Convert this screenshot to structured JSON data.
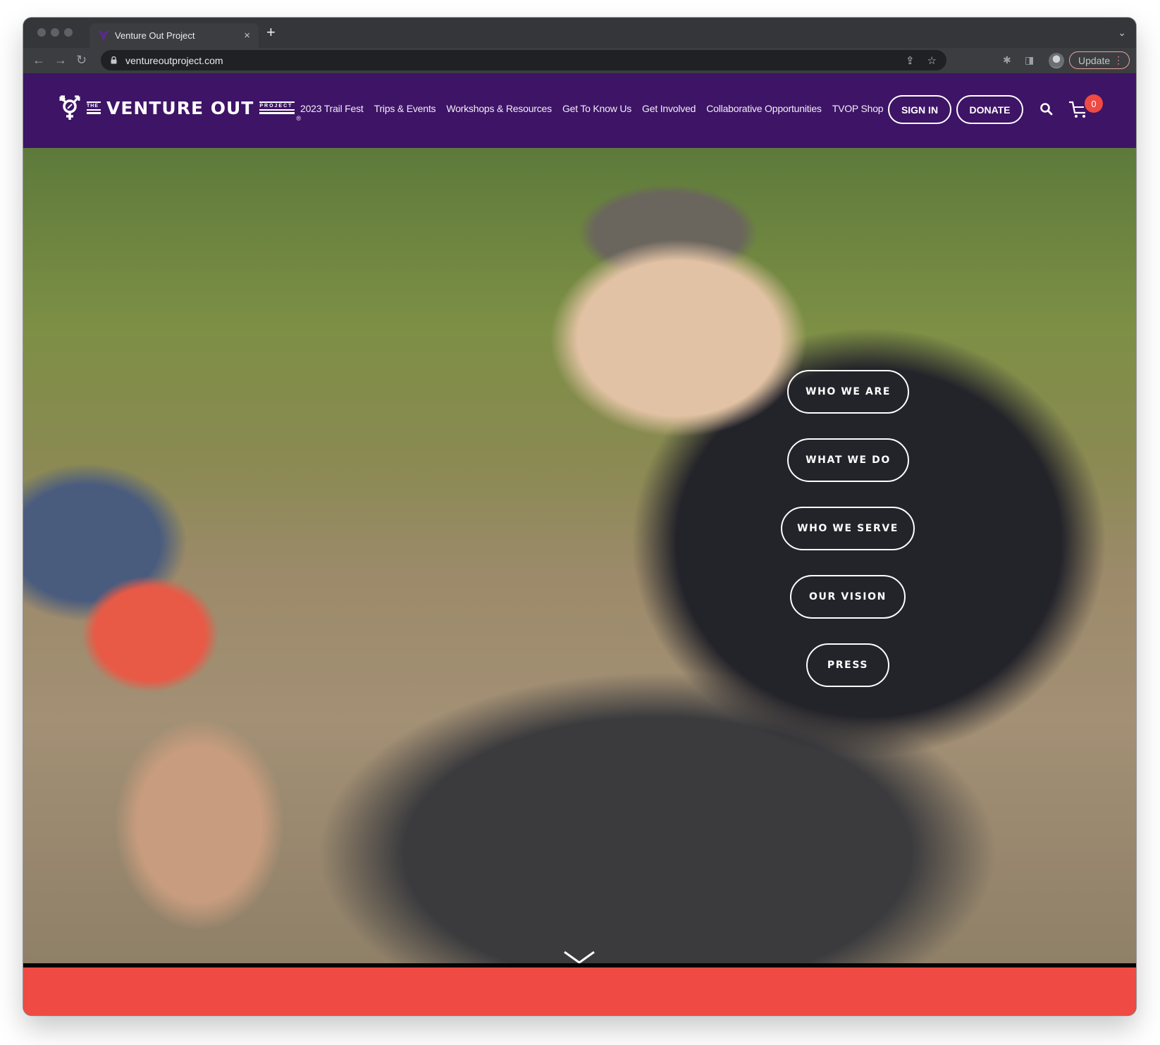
{
  "browser": {
    "tab_title": "Venture Out Project",
    "tab_close": "×",
    "new_tab": "+",
    "tab_menu": "⌄",
    "url": "ventureoutproject.com",
    "back": "←",
    "forward": "→",
    "reload": "↻",
    "share": "⇪",
    "bookmark": "☆",
    "extensions": "✱",
    "sidepanel": "◨",
    "update_label": "Update",
    "menu_dots": "⋮"
  },
  "site": {
    "logo": {
      "the": "THE",
      "name": "VENTURE OUT",
      "project": "PROJECT",
      "registered": "®"
    },
    "nav": [
      {
        "label": "2023 Trail Fest"
      },
      {
        "label": "Trips & Events"
      },
      {
        "label": "Workshops & Resources"
      },
      {
        "label": "Get To Know Us"
      },
      {
        "label": "Get Involved"
      },
      {
        "label": "Collaborative Opportunities"
      },
      {
        "label": "TVOP Shop"
      }
    ],
    "sign_in": "SIGN IN",
    "donate": "DONATE",
    "cart_count": "0",
    "colors": {
      "header": "#3e1466",
      "accent_red": "#ef4a43"
    }
  },
  "hero": {
    "buttons": [
      {
        "label": "WHO WE ARE"
      },
      {
        "label": "WHAT WE DO"
      },
      {
        "label": "WHO WE SERVE"
      },
      {
        "label": "OUR VISION"
      },
      {
        "label": "PRESS"
      }
    ]
  }
}
